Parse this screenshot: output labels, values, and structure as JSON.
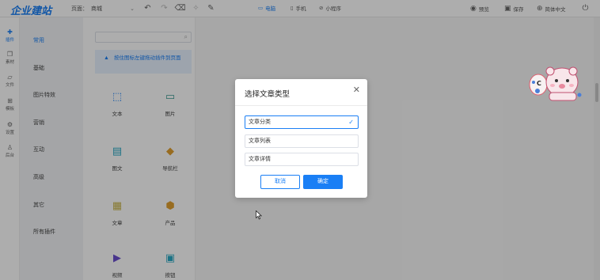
{
  "header": {
    "logo": "企业建站",
    "page_label": "页面：",
    "page_select_value": "商城",
    "devices": [
      {
        "label": "电脑",
        "icon": "monitor-icon",
        "active": true
      },
      {
        "label": "手机",
        "icon": "phone-icon",
        "active": false
      },
      {
        "label": "小程序",
        "icon": "mini-program-icon",
        "active": false
      }
    ],
    "right_tools": [
      {
        "label": "预览",
        "icon": "eye-icon"
      },
      {
        "label": "保存",
        "icon": "save-icon"
      },
      {
        "label": "简体中文",
        "icon": "globe-icon"
      }
    ]
  },
  "rail": {
    "items": [
      "插件",
      "素材",
      "文件",
      "模板",
      "设置",
      "后台"
    ]
  },
  "categories": {
    "items": [
      "常用",
      "基础",
      "图片特效",
      "营销",
      "互动",
      "高级",
      "其它",
      "所有插件"
    ]
  },
  "widget_panel": {
    "search_placeholder": "",
    "notice": "按住图标左键拖动插件到页面",
    "widgets": [
      "文本",
      "图片",
      "图文",
      "导航栏",
      "文章",
      "产品",
      "视频",
      "按钮"
    ]
  },
  "dialog": {
    "title": "选择文章类型",
    "options": [
      "文章分类",
      "文章列表",
      "文章详情"
    ],
    "selected_index": 0,
    "cancel_label": "取消",
    "ok_label": "确定"
  },
  "colors": {
    "accent": "#1a7ff5",
    "panel_bg": "#f2f4f7",
    "notice_bg": "#e8f2ff"
  }
}
